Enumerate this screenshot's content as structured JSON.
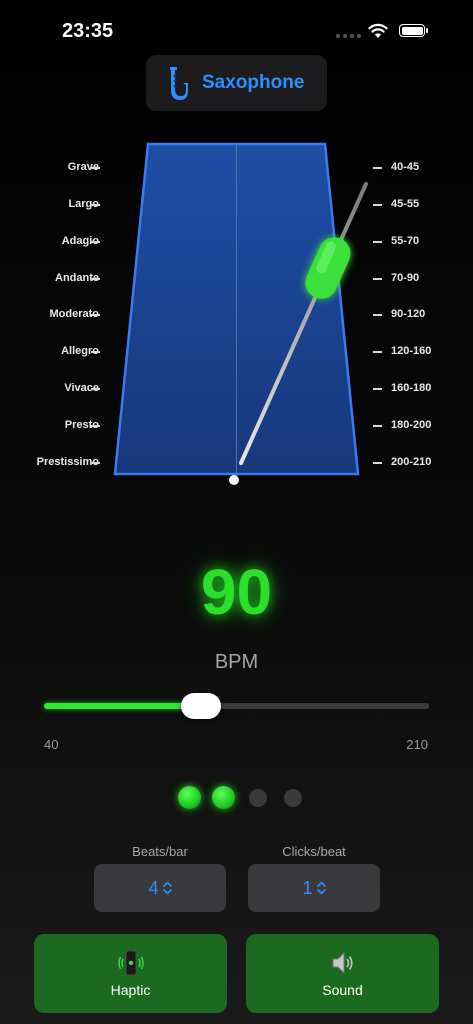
{
  "status_bar": {
    "time": "23:35"
  },
  "instrument": {
    "label": "Saxophone",
    "icon": "saxophone-icon"
  },
  "tempo_markings": {
    "names": [
      "Grave",
      "Largo",
      "Adagio",
      "Andante",
      "Moderato",
      "Allegro",
      "Vivace",
      "Presto",
      "Prestissimo"
    ],
    "ranges": [
      "40-45",
      "45-55",
      "55-70",
      "70-90",
      "90-120",
      "120-160",
      "160-180",
      "180-200",
      "200-210"
    ]
  },
  "bpm": {
    "value": "90",
    "label": "BPM"
  },
  "slider": {
    "min_label": "40",
    "max_label": "210",
    "min": 40,
    "max": 210,
    "value": 90
  },
  "beats": {
    "active": 2,
    "total": 4
  },
  "beats_per_bar": {
    "label": "Beats/bar",
    "value": "4"
  },
  "clicks_per_beat": {
    "label": "Clicks/beat",
    "value": "1"
  },
  "buttons": {
    "haptic": "Haptic",
    "sound": "Sound"
  },
  "colors": {
    "accent_blue": "#2c8fff",
    "bpm_green": "#2be02b",
    "button_green": "#1b6a1f",
    "pendulum_blue": "#1f4fa8"
  }
}
